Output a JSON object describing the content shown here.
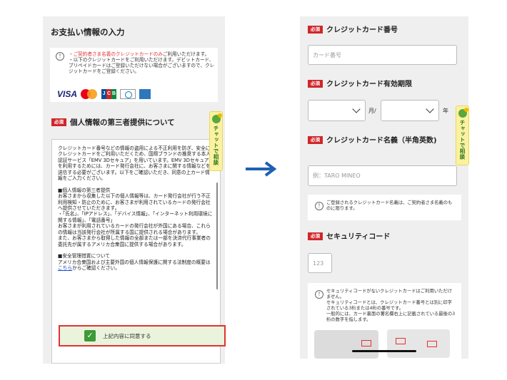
{
  "left": {
    "title": "お支払い情報の入力",
    "notice": {
      "line1_red": "・ご契約者さま名義のクレジットカードのみ",
      "line1_rest": "ご利用いただけます。",
      "line2": "・以下のクレジットカードをご利用いただけます。デビットカード、プリペイドカードはご登録いただけない場合がございますので、クレジットカードをご登録ください。"
    },
    "card_logos": [
      "visa-logo",
      "mastercard-logo",
      "jcb-logo",
      "diners-logo",
      "amex-logo"
    ],
    "logo_visa_text": "VISA",
    "logo_jcb_text": [
      "J",
      "C",
      "B"
    ],
    "third_party_heading": "個人情報の第三者提供について",
    "required_badge": "必須",
    "terms": {
      "p1": "クレジットカード番号などの情報の盗用による不正利用を防ぎ、安全にクレジットカードをご利用いただくため、国際ブランドの推奨する本人認証サービス「EMV 3Dセキュア」を用いています。EMV 3Dセキュアを利用するためには、カード発行会社に、お客さまに関する情報などを送信する必要がございます。以下をご確認いただき、同意の上カード情報をご入力ください。",
      "p2": "■個人情報の第三者提供\nお客さまから収集した以下の個人情報等は、カード発行会社が行う不正利用検知・防止のために、お客さまが利用されているカードの発行会社へ提供させていただきます。\n・「氏名」、「IPアドレス」、「デバイス情報」、「インターネット利用環境に関する情報」、「電話番号」\nお客さまが利用されているカードの発行会社が外国にある場合、これらの情報は当該発行会社が所属する国に提供される場合があります。\nまた、お客さまから取得した情報の全部または一部を決済代行事業者の委託先が属するアメリカ合衆国に提供する場合があります。",
      "p3_a": "■安全管理措置について\nアメリカ合衆国および主要外国の個人情報保護に関する法制度の概要は",
      "p3_link": "こちら",
      "p3_b": "からご確認ください。"
    },
    "agree_label": "上記内容に同意する",
    "checkbox_mark": "✓"
  },
  "chat": {
    "label": "チャットで相談"
  },
  "right": {
    "required_badge": "必須",
    "card_number": {
      "label": "クレジットカード番号",
      "placeholder": "カード番号"
    },
    "expiry": {
      "label": "クレジットカード有効期限",
      "month_unit": "月/",
      "year_unit": "年"
    },
    "holder": {
      "label": "クレジットカード名義（半角英数)",
      "placeholder": "例：TARO MINEO",
      "note": "ご登録されるクレジットカード名義は、ご契約者さま名義のものに限ります。"
    },
    "security": {
      "label": "セキュリティコード",
      "placeholder": "123",
      "note": "セキュリティコードがないクレジットカードはご利用いただけません。\nセキュリティコードとは、クレジットカード番号とは別に印字されている3桁または4桁の番号です。\n一般的には、カード裏面の署名欄右上に記載されている最後の3桁の数字を指します。"
    }
  },
  "colors": {
    "required_red": "#d0262a",
    "agree_border": "#e33232",
    "check_green": "#3f9a38",
    "arrow_blue": "#1f5fb3",
    "link_blue": "#1a4ec8"
  }
}
